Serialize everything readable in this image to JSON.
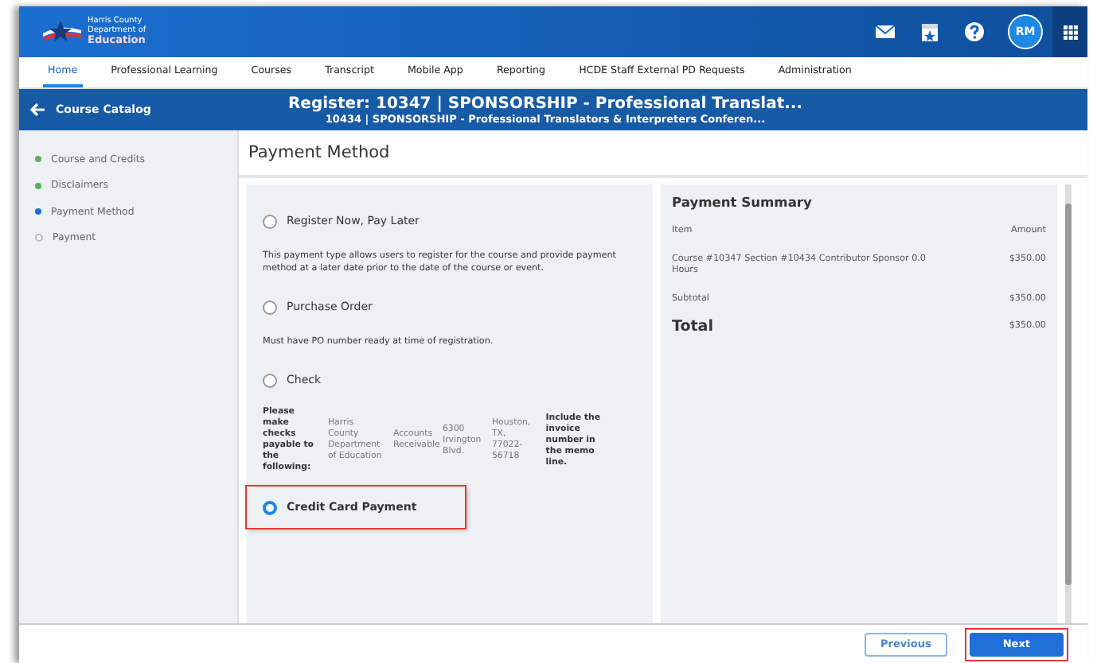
{
  "header": {
    "logo_lines": [
      "Harris County",
      "Department of",
      "Education"
    ],
    "avatar": "RM"
  },
  "nav": [
    {
      "label": "Home",
      "selected": true
    },
    {
      "label": "Professional Learning",
      "selected": false
    },
    {
      "label": "Courses",
      "selected": false
    },
    {
      "label": "Transcript",
      "selected": false
    },
    {
      "label": "Mobile App",
      "selected": false
    },
    {
      "label": "Reporting",
      "selected": false
    },
    {
      "label": "HCDE Staff External PD Requests",
      "selected": false
    },
    {
      "label": "Administration",
      "selected": false
    }
  ],
  "title_bar": {
    "back_label": "Course Catalog",
    "title": "Register: 10347 | SPONSORSHIP - Professional Translat...",
    "subtitle": "10434 | SPONSORSHIP - Professional Translators & Interpreters Conferen..."
  },
  "steps": [
    {
      "label": "Course and Credits",
      "completed": true,
      "selected": false
    },
    {
      "label": "Disclaimers",
      "completed": true,
      "selected": false
    },
    {
      "label": "Payment Method",
      "completed": false,
      "selected": true
    },
    {
      "label": "Payment",
      "completed": false,
      "selected": false
    }
  ],
  "heading": "Payment Method",
  "options": [
    {
      "label": "Register Now, Pay Later",
      "selected": false,
      "highlighted": false,
      "note": "This payment type allows users to register for the course and provide payment method at a later date prior to the date of the course or event."
    },
    {
      "label": "Purchase Order",
      "selected": false,
      "highlighted": false,
      "note": "Must have PO number ready at time of registration."
    },
    {
      "label": "Check",
      "selected": false,
      "highlighted": false,
      "details": [
        "Please make checks payable to the following:",
        "Harris County Department of Education",
        "Accounts Receivable",
        "6300 Irvington Blvd.",
        "Houston, TX, 77022-56718",
        "Include the invoice number in the memo line."
      ]
    },
    {
      "label": "Credit Card Payment",
      "selected": true,
      "highlighted": true
    }
  ],
  "summary": {
    "title": "Payment Summary",
    "columns": [
      "Item",
      "Amount"
    ],
    "rows": [
      {
        "item": "Course #10347 Section #10434 Contributor Sponsor 0.0 Hours",
        "amount": "$350.00"
      }
    ],
    "subtotal": {
      "label": "Subtotal",
      "amount": "$350.00"
    },
    "total": {
      "label": "Total",
      "amount": "$350.00"
    }
  },
  "buttons": [
    {
      "label": "Previous",
      "kind": "secondary",
      "highlighted": false
    },
    {
      "label": "Next",
      "kind": "primary",
      "highlighted": true
    }
  ]
}
